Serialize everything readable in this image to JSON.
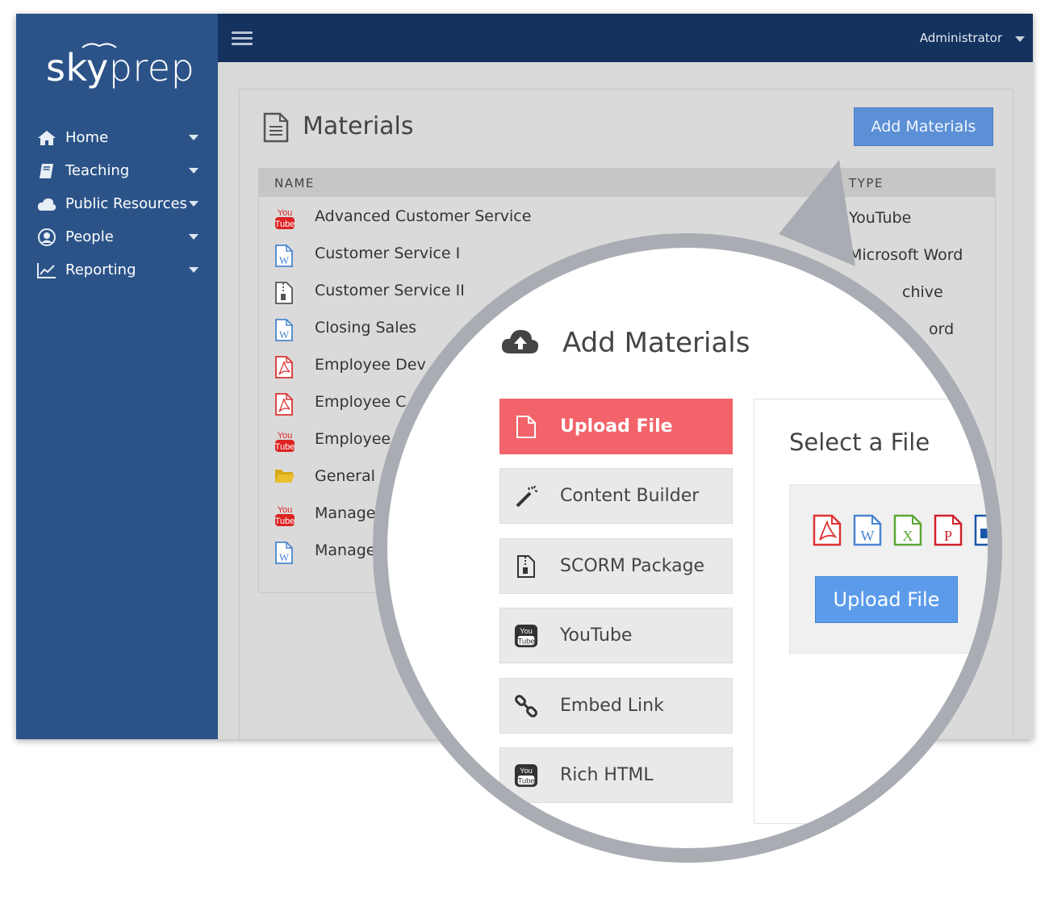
{
  "brand": {
    "logo_sky": "sky",
    "logo_prep": "prep"
  },
  "sidebar": {
    "items": [
      {
        "label": "Home",
        "icon": "home-icon"
      },
      {
        "label": "Teaching",
        "icon": "book-icon"
      },
      {
        "label": "Public Resources",
        "icon": "cloud-icon"
      },
      {
        "label": "People",
        "icon": "user-circle-icon"
      },
      {
        "label": "Reporting",
        "icon": "line-chart-icon"
      }
    ]
  },
  "topbar": {
    "user_label": "Administrator"
  },
  "page": {
    "title": "Materials",
    "add_button": "Add Materials"
  },
  "table": {
    "headers": {
      "name": "NAME",
      "type": "TYPE"
    },
    "rows": [
      {
        "name": "Advanced Customer Service",
        "type": "YouTube",
        "icon": "youtube-icon"
      },
      {
        "name": "Customer Service I",
        "type": "Microsoft Word",
        "icon": "word-file-icon"
      },
      {
        "name": "Customer Service II",
        "type": "",
        "icon": "zip-file-icon"
      },
      {
        "name": "Closing Sales",
        "type": "",
        "icon": "word-file-icon"
      },
      {
        "name": "Employee Dev",
        "type": "",
        "icon": "pdf-file-icon"
      },
      {
        "name": "Employee C",
        "type": "",
        "icon": "pdf-file-icon"
      },
      {
        "name": "Employee",
        "type": "",
        "icon": "youtube-icon"
      },
      {
        "name": "General",
        "type": "",
        "icon": "folder-icon"
      },
      {
        "name": "Manage",
        "type": "",
        "icon": "youtube-icon"
      },
      {
        "name": "Manage",
        "type": "",
        "icon": "word-file-icon"
      }
    ],
    "partial_types": {
      "row3": "chive",
      "row4": "ord"
    }
  },
  "magnifier": {
    "title": "Add Materials",
    "options": [
      {
        "label": "Upload File",
        "icon": "file-icon",
        "active": true
      },
      {
        "label": "Content Builder",
        "icon": "magic-wand-icon",
        "active": false
      },
      {
        "label": "SCORM Package",
        "icon": "zip-file-icon",
        "active": false
      },
      {
        "label": "YouTube",
        "icon": "youtube-icon",
        "active": false
      },
      {
        "label": "Embed Link",
        "icon": "link-icon",
        "active": false
      },
      {
        "label": "Rich HTML",
        "icon": "youtube-icon",
        "active": false
      }
    ],
    "select_title": "Select a File",
    "file_types": [
      "pdf-icon",
      "word-icon",
      "excel-icon",
      "powerpoint-icon",
      "video-icon"
    ],
    "upload_button": "Upload File"
  },
  "colors": {
    "sidebar": "#2b5388",
    "topbar": "#14325e",
    "accent": "#5b8fd6",
    "active": "#f2636a",
    "magnifier_ring": "#a9adb3"
  }
}
